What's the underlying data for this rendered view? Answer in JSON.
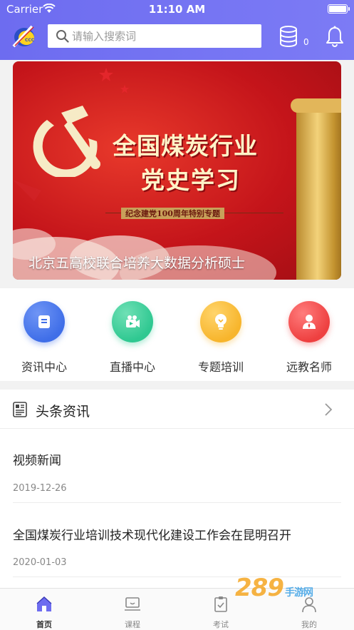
{
  "status_bar": {
    "carrier": "Carrier",
    "time": "11:10 AM"
  },
  "header": {
    "search_placeholder": "请输入搜索词",
    "coin_count": "0",
    "accent_color": "#7271f2"
  },
  "banner": {
    "title_line1": "全国煤炭行业",
    "title_line2": "党史学习",
    "subtitle": "纪念建党100周年特别专题",
    "caption": "北京五高校联合培养大数据分析硕士"
  },
  "quick_links": [
    {
      "label": "资讯中心",
      "icon": "document-icon",
      "color": "#3f6ee8"
    },
    {
      "label": "直播中心",
      "icon": "video-camera-icon",
      "color": "#2fc891"
    },
    {
      "label": "专题培训",
      "icon": "lightbulb-icon",
      "color": "#f7b52c"
    },
    {
      "label": "远教名师",
      "icon": "teacher-icon",
      "color": "#ee4040"
    }
  ],
  "news": {
    "section_title": "头条资讯",
    "articles": [
      {
        "title": "视频新闻",
        "date": "2019-12-26"
      },
      {
        "title": "全国煤炭行业培训技术现代化建设工作会在昆明召开",
        "date": "2020-01-03"
      }
    ]
  },
  "tabs": [
    {
      "label": "首页",
      "icon": "home-icon",
      "active": true
    },
    {
      "label": "课程",
      "icon": "laptop-icon",
      "active": false
    },
    {
      "label": "考试",
      "icon": "clipboard-icon",
      "active": false
    },
    {
      "label": "我的",
      "icon": "user-icon",
      "active": false
    }
  ],
  "watermark": {
    "main": "289",
    "suffix": "手游网"
  }
}
